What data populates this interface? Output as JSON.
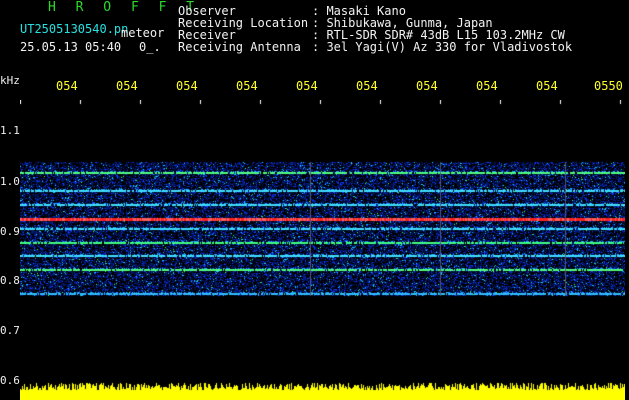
{
  "header": {
    "app_name": "H R O F F T",
    "file_name": "UT2505130540.pn",
    "mode": "meteor",
    "datetime": "25.05.13 05:40",
    "extra": "0_."
  },
  "info": [
    {
      "label": "Observer",
      "value": ": Masaki Kano"
    },
    {
      "label": "Receiving Location",
      "value": ": Shibukawa, Gunma, Japan"
    },
    {
      "label": "Receiver",
      "value": ": RTL-SDR SDR# 43dB L15 103.2MHz CW"
    },
    {
      "label": "Receiving Antenna",
      "value": ": 3el Yagi(V) Az 330 for Vladivostok"
    }
  ],
  "chart_data": {
    "type": "heatmap",
    "ylabel": "kHz",
    "yticks": [
      "1.1",
      "1.0",
      "0.9",
      "0.8",
      "0.7",
      "0.6"
    ],
    "xticks": [
      "054",
      "054",
      "054",
      "054",
      "054",
      "054",
      "054",
      "054",
      "054",
      "0550"
    ],
    "ylim": [
      0.6,
      1.15
    ],
    "colors": {
      "background": "#000000",
      "signal": "#ff2020",
      "noise": "#1a3cff",
      "level": "#ffff00"
    }
  }
}
